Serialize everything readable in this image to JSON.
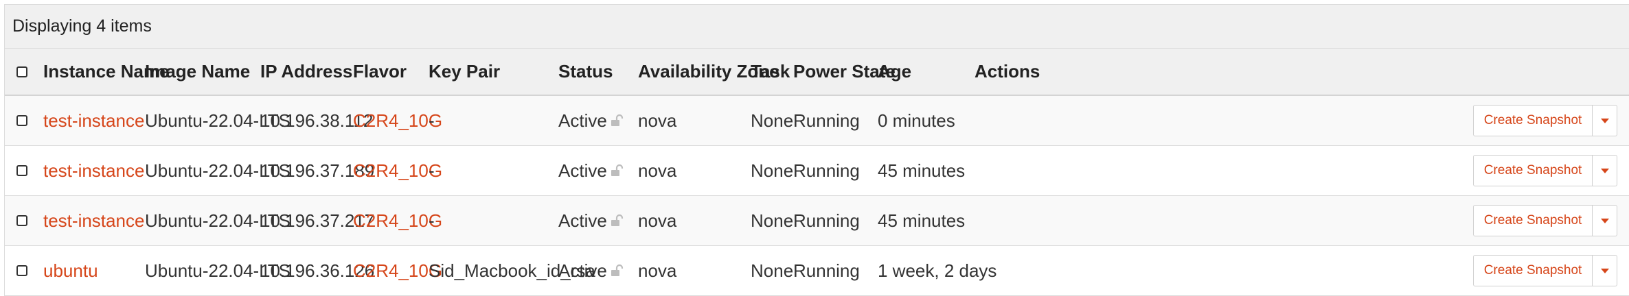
{
  "caption": "Displaying 4 items",
  "columns": {
    "instance_name": "Instance Name",
    "image_name": "Image Name",
    "ip_address": "IP Address",
    "flavor": "Flavor",
    "key_pair": "Key Pair",
    "status": "Status",
    "availability_zone": "Availability Zone",
    "task": "Task",
    "power_state": "Power State",
    "age": "Age",
    "actions": "Actions"
  },
  "rows": [
    {
      "instance_name": "test-instance",
      "image_name": "Ubuntu-22.04-LTS",
      "ip_address": "10.196.38.112",
      "flavor": "C2R4_10G",
      "key_pair": "-",
      "status": "Active",
      "availability_zone": "nova",
      "task": "None",
      "power_state": "Running",
      "age": "0 minutes",
      "action": "Create Snapshot"
    },
    {
      "instance_name": "test-instance",
      "image_name": "Ubuntu-22.04-LTS",
      "ip_address": "10.196.37.189",
      "flavor": "C2R4_10G",
      "key_pair": "-",
      "status": "Active",
      "availability_zone": "nova",
      "task": "None",
      "power_state": "Running",
      "age": "45 minutes",
      "action": "Create Snapshot"
    },
    {
      "instance_name": "test-instance",
      "image_name": "Ubuntu-22.04-LTS",
      "ip_address": "10.196.37.217",
      "flavor": "C2R4_10G",
      "key_pair": "-",
      "status": "Active",
      "availability_zone": "nova",
      "task": "None",
      "power_state": "Running",
      "age": "45 minutes",
      "action": "Create Snapshot"
    },
    {
      "instance_name": "ubuntu",
      "image_name": "Ubuntu-22.04-LTS",
      "ip_address": "10.196.36.126",
      "flavor": "C2R4_10G",
      "key_pair": "Sid_Macbook_id_rsa",
      "status": "Active",
      "availability_zone": "nova",
      "task": "None",
      "power_state": "Running",
      "age": "1 week, 2 days",
      "action": "Create Snapshot"
    }
  ],
  "icons": {
    "status_lock": "unlocked-padlock-icon",
    "actions_menu": "caret-down-icon"
  },
  "colors": {
    "link": "#d6461a",
    "header_bg": "#f0f0f0",
    "odd_row_bg": "#f9f9f9"
  }
}
